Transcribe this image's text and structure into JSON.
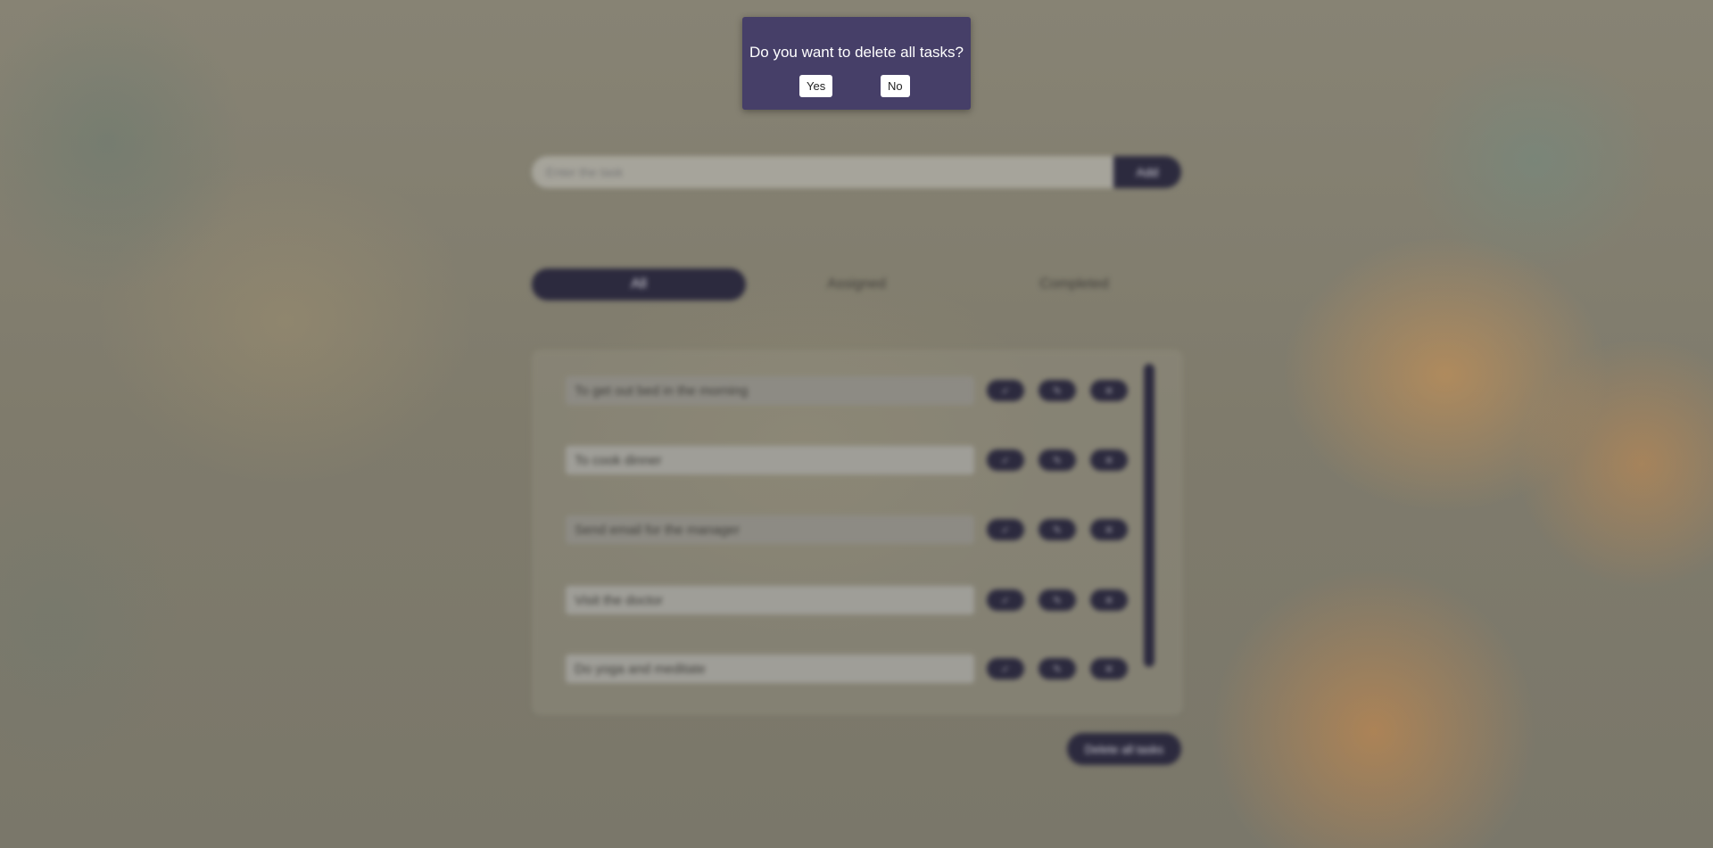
{
  "modal": {
    "message": "Do you want to delete all tasks?",
    "yes_label": "Yes",
    "no_label": "No"
  },
  "task_input": {
    "placeholder": "Enter the task",
    "add_label": "Add"
  },
  "tabs": [
    {
      "label": "All",
      "active": true
    },
    {
      "label": "Assigned",
      "active": false
    },
    {
      "label": "Completed",
      "active": false
    }
  ],
  "tasks": [
    {
      "text": "To get out bed in the morning",
      "completed": true
    },
    {
      "text": "To cook dinner",
      "completed": false
    },
    {
      "text": "Send email for the manager",
      "completed": true
    },
    {
      "text": "Visit the doctor",
      "completed": false
    },
    {
      "text": "Do yoga and meditate",
      "completed": false
    }
  ],
  "task_actions": {
    "complete_label": "✓",
    "edit_label": "✎",
    "delete_label": "✕"
  },
  "footer": {
    "delete_all_label": "Delete all tasks"
  },
  "colors": {
    "modal_bg": "#463f68",
    "accent_dark": "#2c2a3e",
    "modal_text": "#ffffff"
  }
}
